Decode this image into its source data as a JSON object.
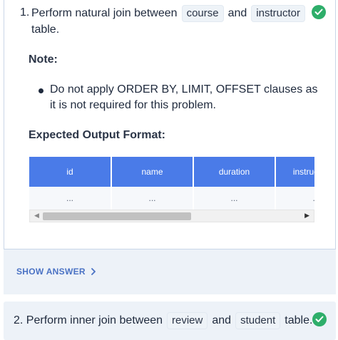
{
  "question1": {
    "number": "1.",
    "text_before": "Perform natural join between",
    "code_a": "course",
    "text_mid": "and",
    "code_b": "instructor",
    "text_after": "table.",
    "status_icon": "check-circle-icon",
    "status_color": "#2eae6a"
  },
  "note": {
    "title": "Note:",
    "items": [
      "Do not apply ORDER BY, LIMIT, OFFSET clauses as it is not required for this problem."
    ]
  },
  "expected_output": {
    "title": "Expected Output Format:",
    "columns": [
      "id",
      "name",
      "duration",
      "instructor_id"
    ],
    "row": [
      "...",
      "...",
      "...",
      "..."
    ],
    "header_color": "#4a7be8"
  },
  "scrollbar": {
    "left_arrow": "◀",
    "right_arrow": "▶"
  },
  "answer_bar": {
    "label": "SHOW ANSWER"
  },
  "question2": {
    "number": "2.",
    "text_before": "Perform inner join between",
    "code_a": "review",
    "text_mid": "and",
    "code_b": "student",
    "text_after": "table.",
    "status_icon": "check-circle-icon"
  }
}
